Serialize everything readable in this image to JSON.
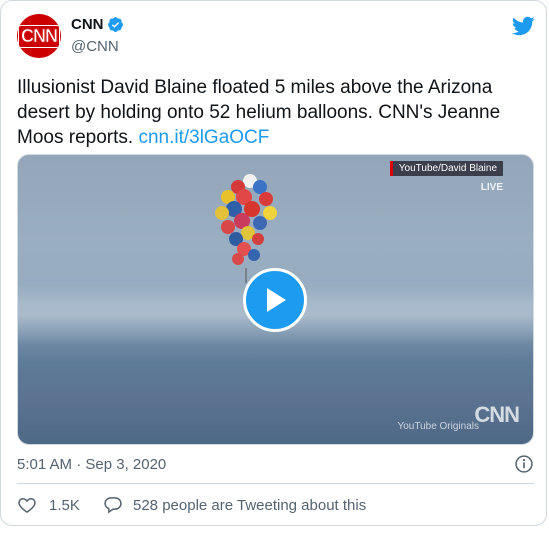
{
  "author": {
    "name": "CNN",
    "handle": "@CNN",
    "avatar_text": "CNN",
    "verified": true
  },
  "tweet": {
    "text": "Illusionist David Blaine floated 5 miles above the Arizona desert by holding onto 52 helium balloons. CNN's Jeanne Moos reports. ",
    "link": "cnn.it/3lGaOCF"
  },
  "media": {
    "source_tag": "YouTube/David Blaine",
    "live_tag": "LIVE",
    "watermark_youtube": "YouTube Originals",
    "watermark_cnn": "CNN",
    "play_icon": "play-icon"
  },
  "meta": {
    "timestamp": "5:01 AM · Sep 3, 2020"
  },
  "actions": {
    "like_count": "1.5K",
    "reply_text": "528 people are Tweeting about this"
  },
  "colors": {
    "accent": "#1d9bf0",
    "brand_red": "#cc0000",
    "muted": "#536471",
    "text": "#0f1419"
  }
}
